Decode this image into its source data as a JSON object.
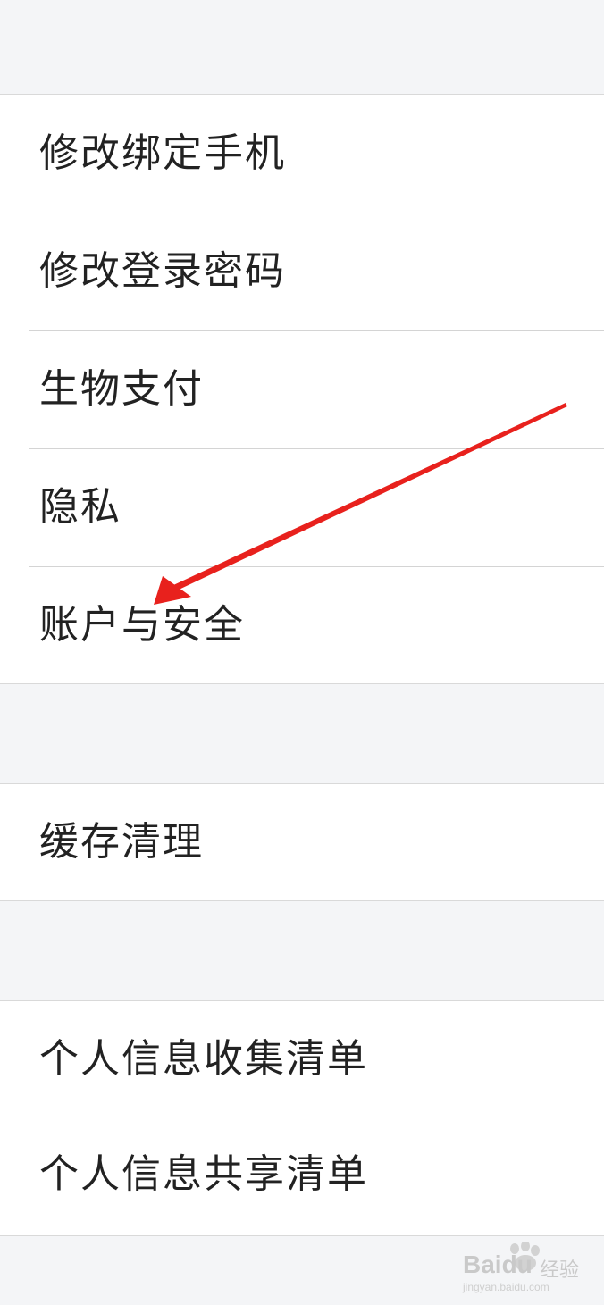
{
  "groups": [
    {
      "items": [
        {
          "label": "修改绑定手机"
        },
        {
          "label": "修改登录密码"
        },
        {
          "label": "生物支付"
        },
        {
          "label": "隐私"
        },
        {
          "label": "账户与安全"
        }
      ]
    },
    {
      "items": [
        {
          "label": "缓存清理"
        }
      ]
    },
    {
      "items": [
        {
          "label": "个人信息收集清单"
        },
        {
          "label": "个人信息共享清单"
        }
      ]
    }
  ],
  "annotation": {
    "color": "#e8211d",
    "points_to": "账户与安全"
  },
  "watermark": {
    "brand": "Baidu",
    "jingyan": "经验",
    "url": "jingyan.baidu.com"
  },
  "colors": {
    "background": "#f4f5f7",
    "row_background": "#ffffff",
    "text": "#222222",
    "divider": "#d4d4d4"
  }
}
